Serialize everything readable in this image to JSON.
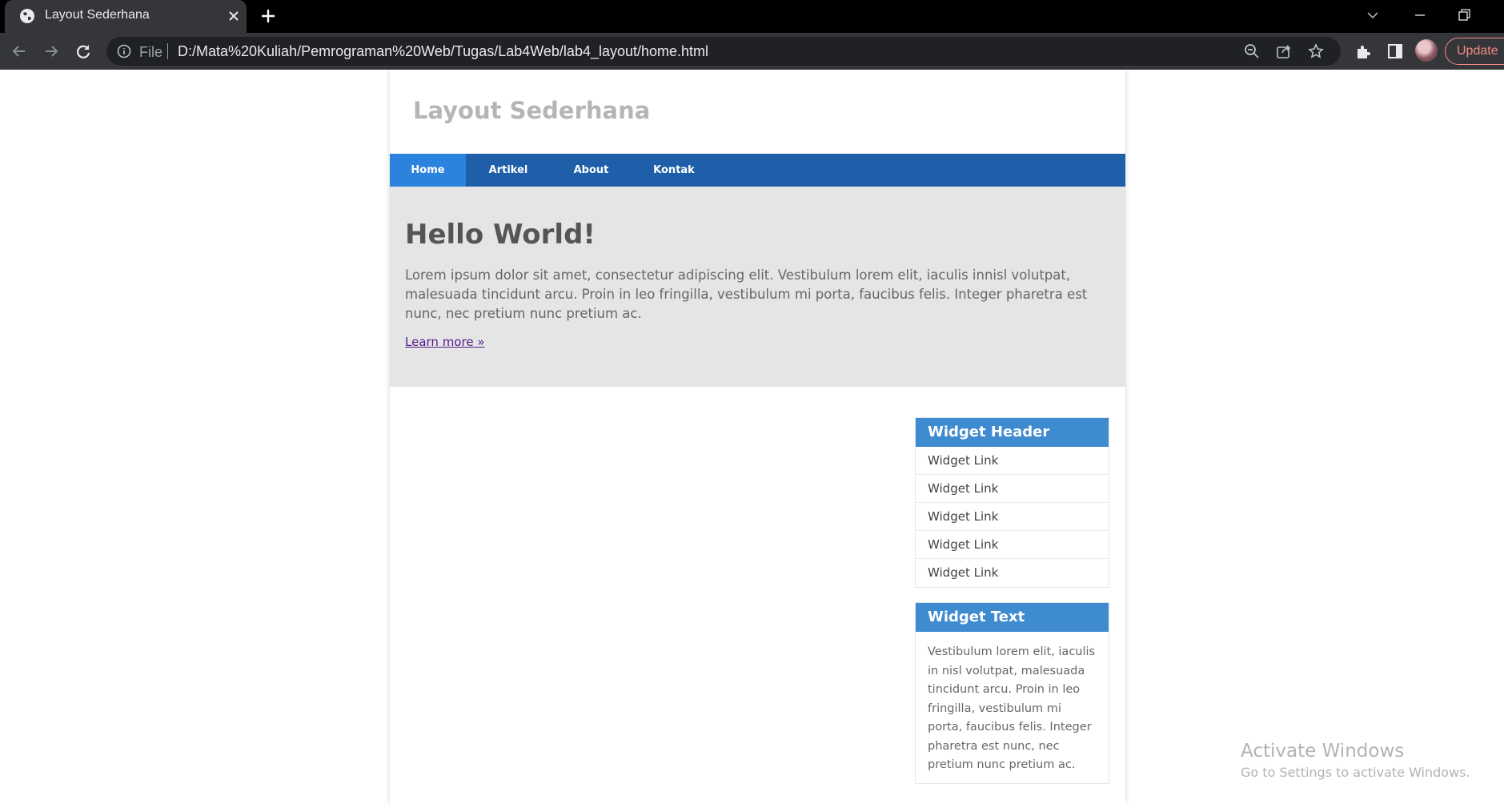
{
  "browser": {
    "tab_title": "Layout Sederhana",
    "scheme_label": "File",
    "url": "D:/Mata%20Kuliah/Pemrograman%20Web/Tugas/Lab4Web/lab4_layout/home.html",
    "update_label": "Update",
    "icons": [
      "globe-icon",
      "close-icon",
      "plus-icon",
      "chevron-down-icon",
      "minimize-icon",
      "restore-icon",
      "back-arrow-icon",
      "forward-arrow-icon",
      "reload-icon",
      "info-icon",
      "zoom-out-icon",
      "share-icon",
      "star-icon",
      "extensions-icon",
      "side-panel-icon"
    ]
  },
  "site": {
    "title": "Layout Sederhana"
  },
  "nav": {
    "items": [
      {
        "label": "Home"
      },
      {
        "label": "Artikel"
      },
      {
        "label": "About"
      },
      {
        "label": "Kontak"
      }
    ]
  },
  "hero": {
    "title": "Hello World!",
    "text": "Lorem ipsum dolor sit amet, consectetur adipiscing elit. Vestibulum lorem elit, iaculis innisl volutpat, malesuada tincidunt arcu. Proin in leo fringilla, vestibulum mi porta, faucibus felis. Integer pharetra est nunc, nec pretium nunc pretium ac.",
    "link": "Learn more »"
  },
  "widgets": {
    "links": {
      "header": "Widget Header",
      "items": [
        "Widget Link",
        "Widget Link",
        "Widget Link",
        "Widget Link",
        "Widget Link"
      ]
    },
    "text": {
      "header": "Widget Text",
      "body": "Vestibulum lorem elit, iaculis in nisl volutpat, malesuada tincidunt arcu. Proin in leo fringilla, vestibulum mi porta, faucibus felis. Integer pharetra est nunc, nec pretium nunc pretium ac."
    }
  },
  "watermark": {
    "title": "Activate Windows",
    "subtitle": "Go to Settings to activate Windows."
  },
  "colors": {
    "nav_bg": "#1f5faa",
    "nav_active": "#2b83de",
    "widget_header": "#3f8bd0",
    "hero_bg": "#e5e5e5"
  }
}
